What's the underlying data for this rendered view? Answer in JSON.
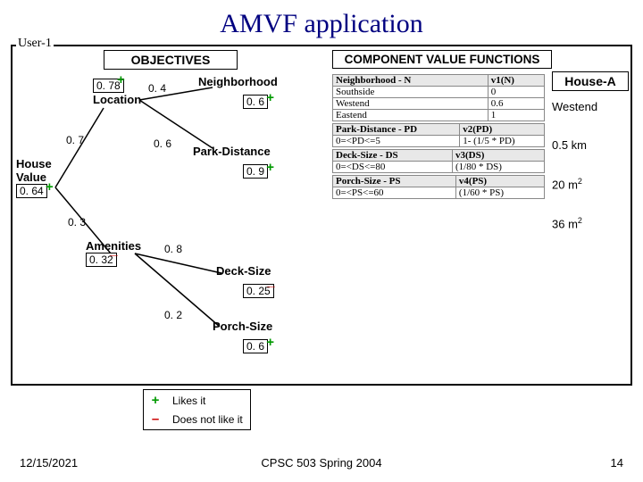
{
  "title": "AMVF application",
  "user_label": "User-1",
  "objectives_header": "OBJECTIVES",
  "cvf_header": "COMPONENT VALUE FUNCTIONS",
  "house_header": "House-A",
  "tree": {
    "root_label": "House\nValue",
    "root_value": "0. 64",
    "location_label": "Location",
    "location_value": "0. 78",
    "edge_house_location": "0. 7",
    "neighborhood_label": "Neighborhood",
    "edge_loc_neigh": "0. 4",
    "neighborhood_value": "0. 6",
    "parkdist_label": "Park-Distance",
    "edge_loc_park": "0. 6",
    "parkdist_value": "0. 9",
    "amenities_label": "Amenities",
    "amenities_value": "0. 32",
    "edge_house_amen": "0. 3",
    "decksize_label": "Deck-Size",
    "edge_amen_deck": "0. 8",
    "decksize_value": "0. 25",
    "porchsize_label": "Porch-Size",
    "edge_amen_porch": "0. 2",
    "porchsize_value": "0. 6"
  },
  "cvf_tables": [
    {
      "col1": "Neighborhood - N",
      "col2": "v1(N)",
      "rows": [
        {
          "a": "Southside",
          "b": "0"
        },
        {
          "a": "Westend",
          "b": "0.6"
        },
        {
          "a": "Eastend",
          "b": "1"
        }
      ]
    },
    {
      "col1": "Park-Distance - PD",
      "col2": "v2(PD)",
      "formula": {
        "a": "0=<PD<=5",
        "b": "1- (1/5 * PD)"
      }
    },
    {
      "col1": "Deck-Size - DS",
      "col2": "v3(DS)",
      "formula": {
        "a": "0=<DS<=80",
        "b": "(1/80 * DS)"
      }
    },
    {
      "col1": "Porch-Size - PS",
      "col2": "v4(PS)",
      "formula": {
        "a": "0=<PS<=60",
        "b": "(1/60 * PS)"
      }
    }
  ],
  "house": {
    "neighborhood": "Westend",
    "park_distance": "0.5 km",
    "deck_size_val": "20 m",
    "deck_size_sup": "2",
    "porch_size_val": "36 m",
    "porch_size_sup": "2"
  },
  "legend": {
    "plus": "Likes it",
    "minus": "Does not like it"
  },
  "footer": {
    "date": "12/15/2021",
    "course": "CPSC 503 Spring 2004",
    "page": "14"
  }
}
